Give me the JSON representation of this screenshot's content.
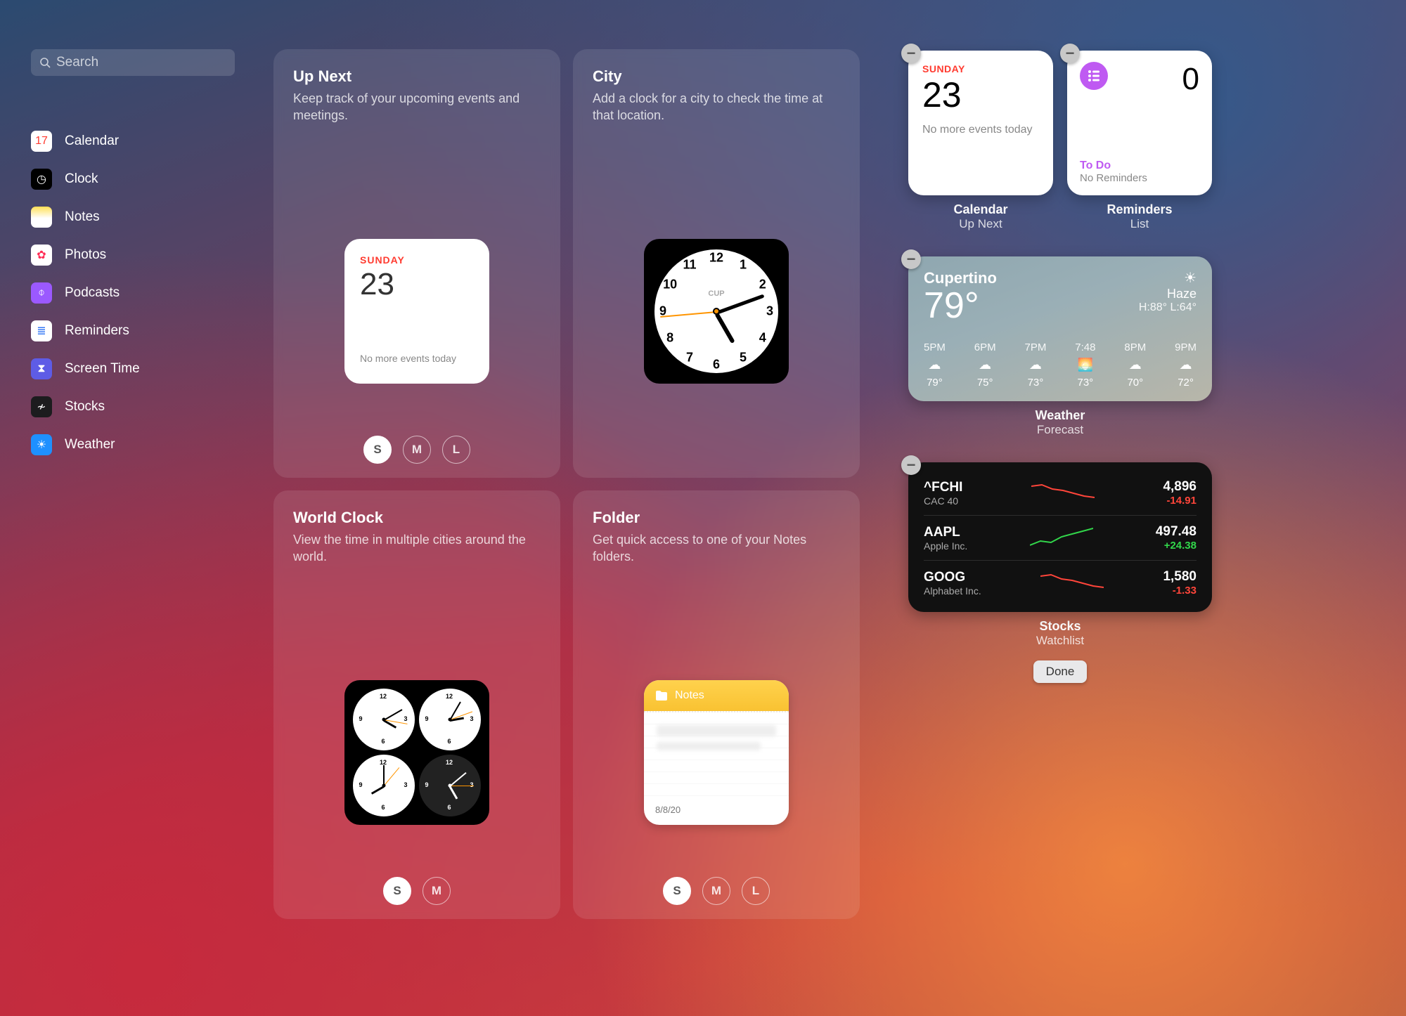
{
  "search": {
    "placeholder": "Search"
  },
  "apps": [
    {
      "name": "Calendar",
      "bg": "#ffffff",
      "glyph": "17",
      "glyphColor": "#ff3b30"
    },
    {
      "name": "Clock",
      "bg": "#000000",
      "glyph": "◷",
      "glyphColor": "#ffffff"
    },
    {
      "name": "Notes",
      "bg": "linear-gradient(#ffdf55,#ffffff 55%)",
      "glyph": "",
      "glyphColor": "#000"
    },
    {
      "name": "Photos",
      "bg": "#ffffff",
      "glyph": "✿",
      "glyphColor": "#ff2d55"
    },
    {
      "name": "Podcasts",
      "bg": "#9b59ff",
      "glyph": "⌽",
      "glyphColor": "#ffffff"
    },
    {
      "name": "Reminders",
      "bg": "#ffffff",
      "glyph": "≣",
      "glyphColor": "#3478f6"
    },
    {
      "name": "Screen Time",
      "bg": "#5e5ce6",
      "glyph": "⧗",
      "glyphColor": "#ffffff"
    },
    {
      "name": "Stocks",
      "bg": "#1c1c1e",
      "glyph": "≁",
      "glyphColor": "#ffffff"
    },
    {
      "name": "Weather",
      "bg": "#1e90ff",
      "glyph": "☀",
      "glyphColor": "#ffffff"
    }
  ],
  "gallery": {
    "up_next": {
      "title": "Up Next",
      "desc": "Keep track of your upcoming events and meetings.",
      "day_of_week": "SUNDAY",
      "day_num": "23",
      "no_events": "No more events today",
      "sizes": [
        "S",
        "M",
        "L"
      ],
      "size_active": "S"
    },
    "city": {
      "title": "City",
      "desc": "Add a clock for a city to check the time at that location.",
      "label": "CUP"
    },
    "world_clock": {
      "title": "World Clock",
      "desc": "View the time in multiple cities around the world.",
      "sizes": [
        "S",
        "M"
      ],
      "size_active": "S"
    },
    "folder": {
      "title": "Folder",
      "desc": "Get quick access to one of your Notes folders.",
      "notes_label": "Notes",
      "note_date": "8/8/20",
      "sizes": [
        "S",
        "M",
        "L"
      ],
      "size_active": "S"
    }
  },
  "widgets": {
    "calendar": {
      "app": "Calendar",
      "kind": "Up Next",
      "day_of_week": "SUNDAY",
      "day_num": "23",
      "no_events": "No more events today"
    },
    "reminders": {
      "app": "Reminders",
      "kind": "List",
      "count": "0",
      "list_name": "To Do",
      "empty": "No Reminders"
    },
    "weather": {
      "app": "Weather",
      "kind": "Forecast",
      "city": "Cupertino",
      "temp": "79°",
      "condition": "Haze",
      "hilo": "H:88° L:64°",
      "hours": [
        {
          "t": "5PM",
          "icon": "☁︎",
          "temp": "79°"
        },
        {
          "t": "6PM",
          "icon": "☁︎",
          "temp": "75°"
        },
        {
          "t": "7PM",
          "icon": "☁︎",
          "temp": "73°"
        },
        {
          "t": "7:48",
          "icon": "🌅",
          "temp": "73°"
        },
        {
          "t": "8PM",
          "icon": "☁︎",
          "temp": "70°"
        },
        {
          "t": "9PM",
          "icon": "☁︎",
          "temp": "72°"
        }
      ]
    },
    "stocks": {
      "app": "Stocks",
      "kind": "Watchlist",
      "rows": [
        {
          "sym": "^FCHI",
          "name": "CAC 40",
          "price": "4,896",
          "chg": "-14.91",
          "dir": "neg"
        },
        {
          "sym": "AAPL",
          "name": "Apple Inc.",
          "price": "497.48",
          "chg": "+24.38",
          "dir": "pos"
        },
        {
          "sym": "GOOG",
          "name": "Alphabet Inc.",
          "price": "1,580",
          "chg": "-1.33",
          "dir": "neg"
        }
      ]
    }
  },
  "done": "Done"
}
